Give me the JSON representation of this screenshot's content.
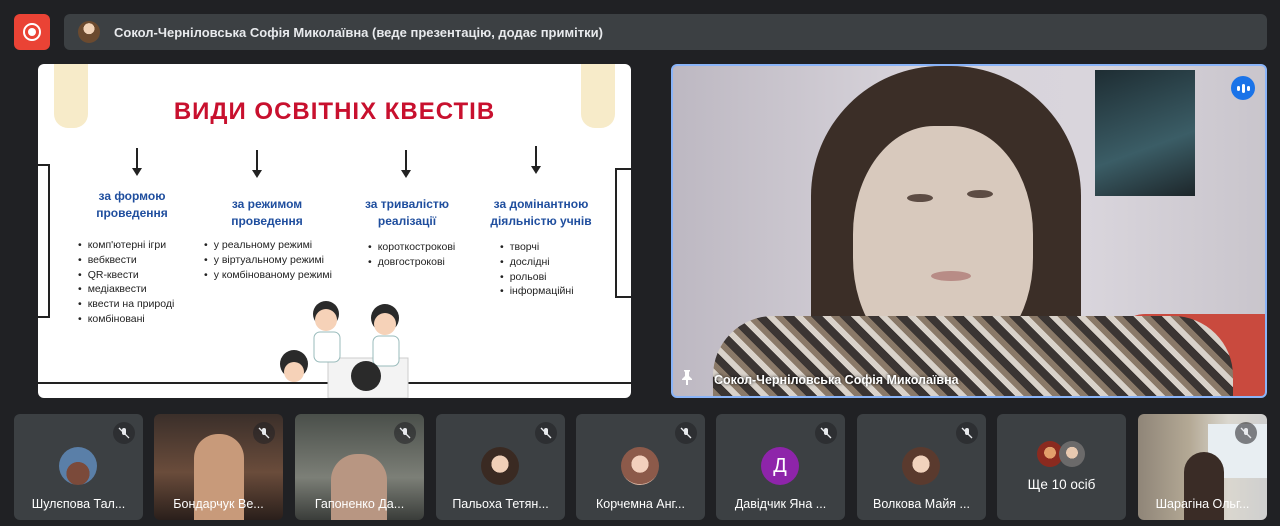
{
  "presentation_banner": {
    "text": "Сокол-Черніловська Софія Миколаївна (веде презентацію, додає примітки)"
  },
  "slide": {
    "title": "ВИДИ ОСВІТНІХ КВЕСТІВ",
    "columns": [
      {
        "heading_line1": "за формою",
        "heading_line2": "проведення",
        "items": [
          "комп'ютерні ігри",
          "вебквести",
          "QR-квести",
          "медіаквести",
          "квести на природі",
          "комбіновані"
        ]
      },
      {
        "heading_line1": "за режимом",
        "heading_line2": "проведення",
        "items": [
          "у реальному режимі",
          "у віртуальному режимі",
          "у комбінованому режимі"
        ]
      },
      {
        "heading_line1": "за тривалістю",
        "heading_line2": "реалізації",
        "items": [
          "короткострокові",
          "довгострокові"
        ]
      },
      {
        "heading_line1": "за домінантною",
        "heading_line2": "діяльністю учнів",
        "items": [
          "творчі",
          "дослідні",
          "рольові",
          "інформаційні"
        ]
      }
    ]
  },
  "speaker": {
    "name": "Сокол-Черніловська Софія Миколаївна"
  },
  "participants": [
    {
      "name": "Шулєпова Тал...",
      "avatar": "photo",
      "muted": true
    },
    {
      "name": "Бондарчук Ве...",
      "avatar": "video",
      "muted": true
    },
    {
      "name": "Гапоненко Да...",
      "avatar": "video",
      "muted": true
    },
    {
      "name": "Пальоха Тетян...",
      "avatar": "photo",
      "muted": true
    },
    {
      "name": "Корчемна Анг...",
      "avatar": "photo",
      "muted": true
    },
    {
      "name": "Давідчик Яна ...",
      "avatar": "letter",
      "letter": "Д",
      "muted": true
    },
    {
      "name": "Волкова Майя ...",
      "avatar": "photo",
      "muted": true
    }
  ],
  "more_tile": {
    "label": "Ще 10 осіб"
  },
  "last_tile": {
    "name": "Шарагіна Ольг...",
    "muted": true
  },
  "colors": {
    "background": "#202124",
    "tile": "#3c4043",
    "record": "#ea4335",
    "active_border": "#8ab4f8",
    "slide_title": "#c8102e",
    "slide_heading": "#1f4e9e",
    "letter_avatar": "#8e24aa"
  }
}
